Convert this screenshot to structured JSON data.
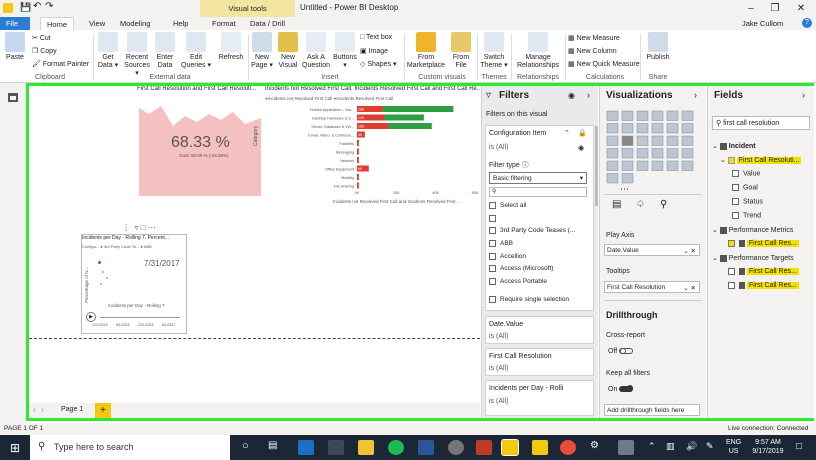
{
  "titlebar": {
    "context_tab": "Visual tools",
    "title": "Untitled - Power BI Desktop",
    "user": "Jake Cullom"
  },
  "tabs": [
    "File",
    "Home",
    "View",
    "Modeling",
    "Help",
    "Format",
    "Data / Drill"
  ],
  "ribbon": {
    "cut": "Cut",
    "copy": "Copy",
    "format_painter": "Format Painter",
    "paste": "Paste",
    "get_data": "Get Data ▾",
    "recent_sources": "Recent Sources ▾",
    "enter_data": "Enter Data",
    "edit_queries": "Edit Queries ▾",
    "refresh": "Refresh",
    "new_page": "New Page ▾",
    "new_visual": "New Visual",
    "ask_question": "Ask A Question",
    "buttons": "Buttons ▾",
    "text_box": "Text box",
    "image": "Image",
    "shapes": "Shapes ▾",
    "from_marketplace": "From Marketplace",
    "from_file": "From File",
    "switch_theme": "Switch Theme ▾",
    "manage_relationships": "Manage Relationships",
    "new_measure": "New Measure",
    "new_column": "New Column",
    "new_quick_measure": "New Quick Measure",
    "publish": "Publish",
    "groups": {
      "clipboard": "Clipboard",
      "external": "External data",
      "insert": "Insert",
      "custom": "Custom visuals",
      "themes": "Themes",
      "relationships": "Relationships",
      "calculations": "Calculations",
      "share": "Share"
    }
  },
  "report": {
    "kpi_title": "First Call Resolution and First Call Resoluti...",
    "kpi_value": "68.33 %",
    "kpi_goal": "Goal: 90.00 % (-24.08%)",
    "bar_title": "Incidents not Resolved First Call, Incidents Resolved First Call and First Call Re...",
    "bar_legend_a": "Incidents not Resolved First Call",
    "bar_legend_b": "Incidents Resolved First Call",
    "bar_xlabel": "Incidents not Resolved First Call and Incidents Resolved First ...",
    "bar_ylabel": "Category",
    "scatter_title": "Incidents per Day - Rolling 7, Percent...",
    "scatter_legend": "Configu... ● 3rd Party Code Te... ● ABB",
    "scatter_date": "7/31/2017",
    "scatter_ylabel": "Percentage of N...",
    "scatter_xlabel": "Incidents per Day - Rolling 7",
    "scatter_ticks": [
      "12/1/2015",
      "6/1/2016",
      "12/1/2016",
      "6/1/2017"
    ],
    "page_tab": "Page 1"
  },
  "chart_data": {
    "type": "bar",
    "categories": [
      "Hosted Application – Ma...",
      "Desktop Hardware & S...",
      "Server, Database & Virt...",
      "Email, Video, & Conferen...",
      "Facilities",
      "Messaging",
      "Network",
      "Office Equipment",
      "Mobility",
      "File Sharing"
    ],
    "series": [
      {
        "name": "Incidents not Resolved First Call",
        "values": [
          13,
          14,
          16,
          4,
          1,
          1,
          1,
          6,
          1,
          1
        ]
      },
      {
        "name": "Incidents Resolved First Call",
        "values": [
          36,
          20,
          22,
          0,
          0,
          0,
          0,
          0,
          0,
          0
        ]
      }
    ],
    "data_labels": [
      "13K",
      "14K",
      "16K",
      "4K",
      "1K",
      "1K",
      "1K",
      "6K",
      "1K",
      "1K"
    ],
    "x_ticks": [
      "0K",
      "20K",
      "40K",
      "60K"
    ],
    "xlim": [
      0,
      60
    ],
    "colors": [
      "#e03c31",
      "#2e9e44"
    ]
  },
  "filters": {
    "title": "Filters",
    "on_visual": "Filters on this visual",
    "config_item": "Configuration Item",
    "is_all": "is (All)",
    "filter_type": "Filter type ⓘ",
    "basic": "Basic filtering",
    "items": [
      "Select all",
      "",
      "3rd Party Code Teases (...",
      "ABB",
      "Accellion",
      "Access (Microsoft)",
      "Access Portable"
    ],
    "require_single": "Require single selection",
    "date_value": "Date.Value",
    "first_call": "First Call Resolution",
    "incidents_day": "Incidents per Day - Rolli",
    "is_all_partial": "is (All)"
  },
  "viz": {
    "title": "Visualizations",
    "play_axis": "Play Axis",
    "play_value": "Date.Value",
    "tooltips": "Tooltips",
    "tooltip_value": "First Call Resolution",
    "drill": "Drillthrough",
    "cross_report": "Cross-report",
    "off": "Off",
    "keep_all": "Keep all filters",
    "on": "On",
    "add_drill": "Add drillthrough fields here"
  },
  "fields": {
    "title": "Fields",
    "search": "first call resolution",
    "incident": "Incident",
    "fcr": "First Call Resoluti...",
    "value": "Value",
    "goal": "Goal",
    "status": "Status",
    "trend": "Trend",
    "perf_metrics": "Performance Metrics",
    "fcr_short": "First Call Res...",
    "perf_targets": "Performance Targets"
  },
  "status": {
    "page": "PAGE 1 OF 1",
    "live": "Live connection: Connected"
  },
  "taskbar": {
    "search": "Type here to search",
    "time": "9:57 AM",
    "date": "9/17/2019",
    "lang": "ENG",
    "region": "US"
  }
}
